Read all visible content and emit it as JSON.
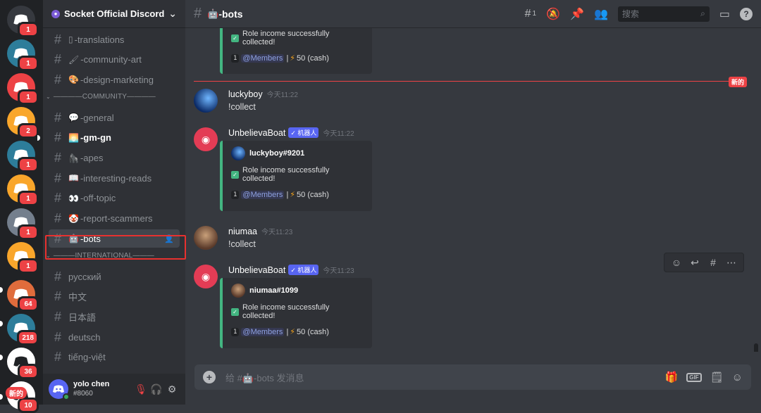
{
  "server_rail": {
    "servers": [
      {
        "name": "direct-messages",
        "color": "#36393f",
        "badge": "1"
      },
      {
        "name": "server-tree-1",
        "color": "#2d7d9a",
        "badge": "1"
      },
      {
        "name": "server-discord-red",
        "color": "#ed4245",
        "badge": "1"
      },
      {
        "name": "server-discord-orange-1",
        "color": "#f9a62b",
        "badge": "2"
      },
      {
        "name": "server-tree-2",
        "color": "#2d7d9a",
        "badge": "1"
      },
      {
        "name": "server-discord-orange-2",
        "color": "#f9a62b",
        "badge": "1"
      },
      {
        "name": "server-discord-gray",
        "color": "#747f8d",
        "badge": "1"
      },
      {
        "name": "server-discord-orange-3",
        "color": "#f9a62b",
        "badge": "1"
      },
      {
        "name": "server-colorful",
        "color": "#e06c3c",
        "badge": "64"
      },
      {
        "name": "server-tree-3",
        "color": "#2d7d9a",
        "badge": "218"
      },
      {
        "name": "server-socket",
        "color": "#ffffff",
        "badge": "36"
      },
      {
        "name": "server-bottom",
        "color": "#ffffff",
        "badge": "10"
      }
    ],
    "new_label": "新的"
  },
  "guild": {
    "name": "Socket Official Discord"
  },
  "channels": [
    {
      "name": "-translations",
      "emoji": "▯",
      "state": "normal"
    },
    {
      "name": "-community-art",
      "emoji": "🖌",
      "state": "normal"
    },
    {
      "name": "-design-marketing",
      "emoji": "🎨",
      "state": "normal"
    },
    {
      "category": "————COMMUNITY————"
    },
    {
      "name": "-general",
      "emoji": "💬",
      "state": "normal"
    },
    {
      "name": "-gm-gn",
      "emoji": "🌅",
      "state": "unread"
    },
    {
      "name": "-apes",
      "emoji": "🦍",
      "state": "normal"
    },
    {
      "name": "-interesting-reads",
      "emoji": "📖",
      "state": "normal"
    },
    {
      "name": "-off-topic",
      "emoji": "👀",
      "state": "normal"
    },
    {
      "name": "-report-scammers",
      "emoji": "🤡",
      "state": "normal"
    },
    {
      "name": "-bots",
      "emoji": "🤖",
      "state": "active"
    },
    {
      "category": "———INTERNATIONAL———"
    },
    {
      "name": "русский",
      "emoji": "",
      "state": "normal"
    },
    {
      "name": "中文",
      "emoji": "",
      "state": "normal"
    },
    {
      "name": "日本語",
      "emoji": "",
      "state": "normal"
    },
    {
      "name": "deutsch",
      "emoji": "",
      "state": "normal"
    },
    {
      "name": "tiếng-việt",
      "emoji": "",
      "state": "normal"
    }
  ],
  "user": {
    "name": "yolo chen",
    "discriminator": "#8060"
  },
  "topbar": {
    "channel": "-bots",
    "channel_emoji": "🤖",
    "threads_count": "1",
    "search_placeholder": "搜索"
  },
  "messages": {
    "new_divider": "新的",
    "partial_embed": {
      "line1": "Role income successfully collected!",
      "rank": "1",
      "mention": "@Members",
      "amount": "50 (cash)"
    },
    "m1": {
      "author": "luckyboy",
      "time": "今天11:22",
      "text": "!collect"
    },
    "m2": {
      "author": "UnbelievaBoat",
      "bot_tag": "✓ 机器人",
      "time": "今天11:22",
      "embed_author": "luckyboy#9201",
      "line1": "Role income successfully collected!",
      "rank": "1",
      "mention": "@Members",
      "amount": "50 (cash)"
    },
    "m3": {
      "author": "niumaa",
      "time": "今天11:23",
      "text": "!collect"
    },
    "m4": {
      "author": "UnbelievaBoat",
      "bot_tag": "✓ 机器人",
      "time": "今天11:23",
      "embed_author": "niumaa#1099",
      "line1": "Role income successfully collected!",
      "rank": "1",
      "mention": "@Members",
      "amount": "50 (cash)"
    }
  },
  "composer": {
    "placeholder": "给 #🤖-bots 发消息",
    "gif_label": "GIF"
  }
}
